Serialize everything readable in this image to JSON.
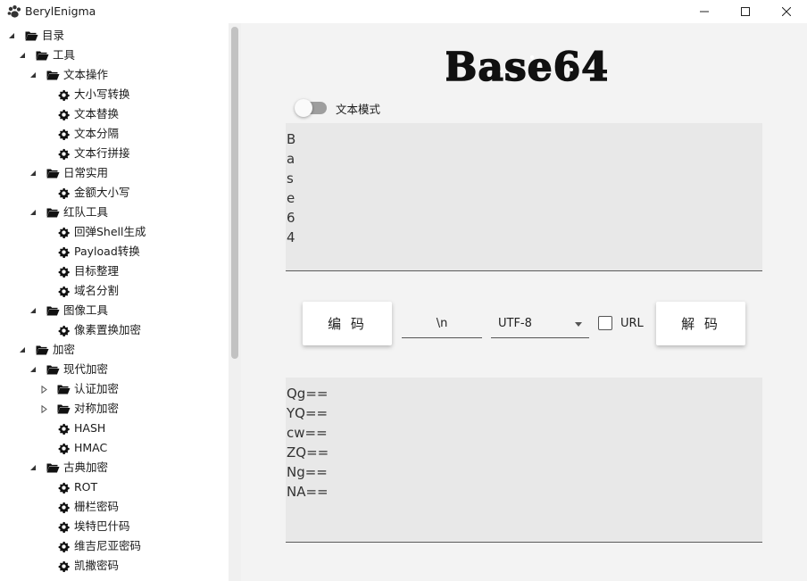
{
  "window": {
    "title": "BerylEnigma"
  },
  "sidebar": {
    "items": [
      {
        "label": "目录",
        "icon": "folder-open-icon",
        "expander": "expanded",
        "level": 0
      },
      {
        "label": "工具",
        "icon": "folder-open-icon",
        "expander": "expanded",
        "level": 1
      },
      {
        "label": "文本操作",
        "icon": "folder-open-icon",
        "expander": "expanded",
        "level": 2
      },
      {
        "label": "大小写转换",
        "icon": "gear-icon",
        "expander": "none",
        "level": 3
      },
      {
        "label": "文本替换",
        "icon": "gear-icon",
        "expander": "none",
        "level": 3
      },
      {
        "label": "文本分隔",
        "icon": "gear-icon",
        "expander": "none",
        "level": 3
      },
      {
        "label": "文本行拼接",
        "icon": "gear-icon",
        "expander": "none",
        "level": 3
      },
      {
        "label": "日常实用",
        "icon": "folder-open-icon",
        "expander": "expanded",
        "level": 2
      },
      {
        "label": "金额大小写",
        "icon": "gear-icon",
        "expander": "none",
        "level": 3
      },
      {
        "label": "红队工具",
        "icon": "folder-open-icon",
        "expander": "expanded",
        "level": 2
      },
      {
        "label": "回弹Shell生成",
        "icon": "gear-icon",
        "expander": "none",
        "level": 3
      },
      {
        "label": "Payload转换",
        "icon": "gear-icon",
        "expander": "none",
        "level": 3
      },
      {
        "label": "目标整理",
        "icon": "gear-icon",
        "expander": "none",
        "level": 3
      },
      {
        "label": "域名分割",
        "icon": "gear-icon",
        "expander": "none",
        "level": 3
      },
      {
        "label": "图像工具",
        "icon": "folder-open-icon",
        "expander": "expanded",
        "level": 2
      },
      {
        "label": "像素置换加密",
        "icon": "gear-icon",
        "expander": "none",
        "level": 3
      },
      {
        "label": "加密",
        "icon": "folder-open-icon",
        "expander": "expanded",
        "level": 1
      },
      {
        "label": "现代加密",
        "icon": "folder-open-icon",
        "expander": "expanded",
        "level": 2
      },
      {
        "label": "认证加密",
        "icon": "folder-open-icon",
        "expander": "collapsed",
        "level": 3
      },
      {
        "label": "对称加密",
        "icon": "folder-open-icon",
        "expander": "collapsed",
        "level": 3
      },
      {
        "label": "HASH",
        "icon": "gear-icon",
        "expander": "none",
        "level": 3
      },
      {
        "label": "HMAC",
        "icon": "gear-icon",
        "expander": "none",
        "level": 3
      },
      {
        "label": "古典加密",
        "icon": "folder-open-icon",
        "expander": "expanded",
        "level": 2
      },
      {
        "label": "ROT",
        "icon": "gear-icon",
        "expander": "none",
        "level": 3
      },
      {
        "label": "栅栏密码",
        "icon": "gear-icon",
        "expander": "none",
        "level": 3
      },
      {
        "label": "埃特巴什码",
        "icon": "gear-icon",
        "expander": "none",
        "level": 3
      },
      {
        "label": "维吉尼亚密码",
        "icon": "gear-icon",
        "expander": "none",
        "level": 3
      },
      {
        "label": "凯撒密码",
        "icon": "gear-icon",
        "expander": "none",
        "level": 3
      }
    ]
  },
  "main": {
    "logo_text": "Base64",
    "text_mode_label": "文本模式",
    "text_mode_on": false,
    "input_lines": [
      "B",
      "a",
      "s",
      "e",
      "6",
      "4"
    ],
    "encode_label": "编 码",
    "newline_value": "\\n",
    "charset_value": "UTF-8",
    "url_label": "URL",
    "url_checked": false,
    "decode_label": "解 码",
    "output_lines": [
      "Qg==",
      "YQ==",
      "cw==",
      "ZQ==",
      "Ng==",
      "NA=="
    ]
  },
  "colors": {
    "sidebar_bg": "#ffffff",
    "main_bg": "#f3f3f3",
    "textbox_bg": "#e8e8e8",
    "toggle_track": "#9e9e9e"
  }
}
